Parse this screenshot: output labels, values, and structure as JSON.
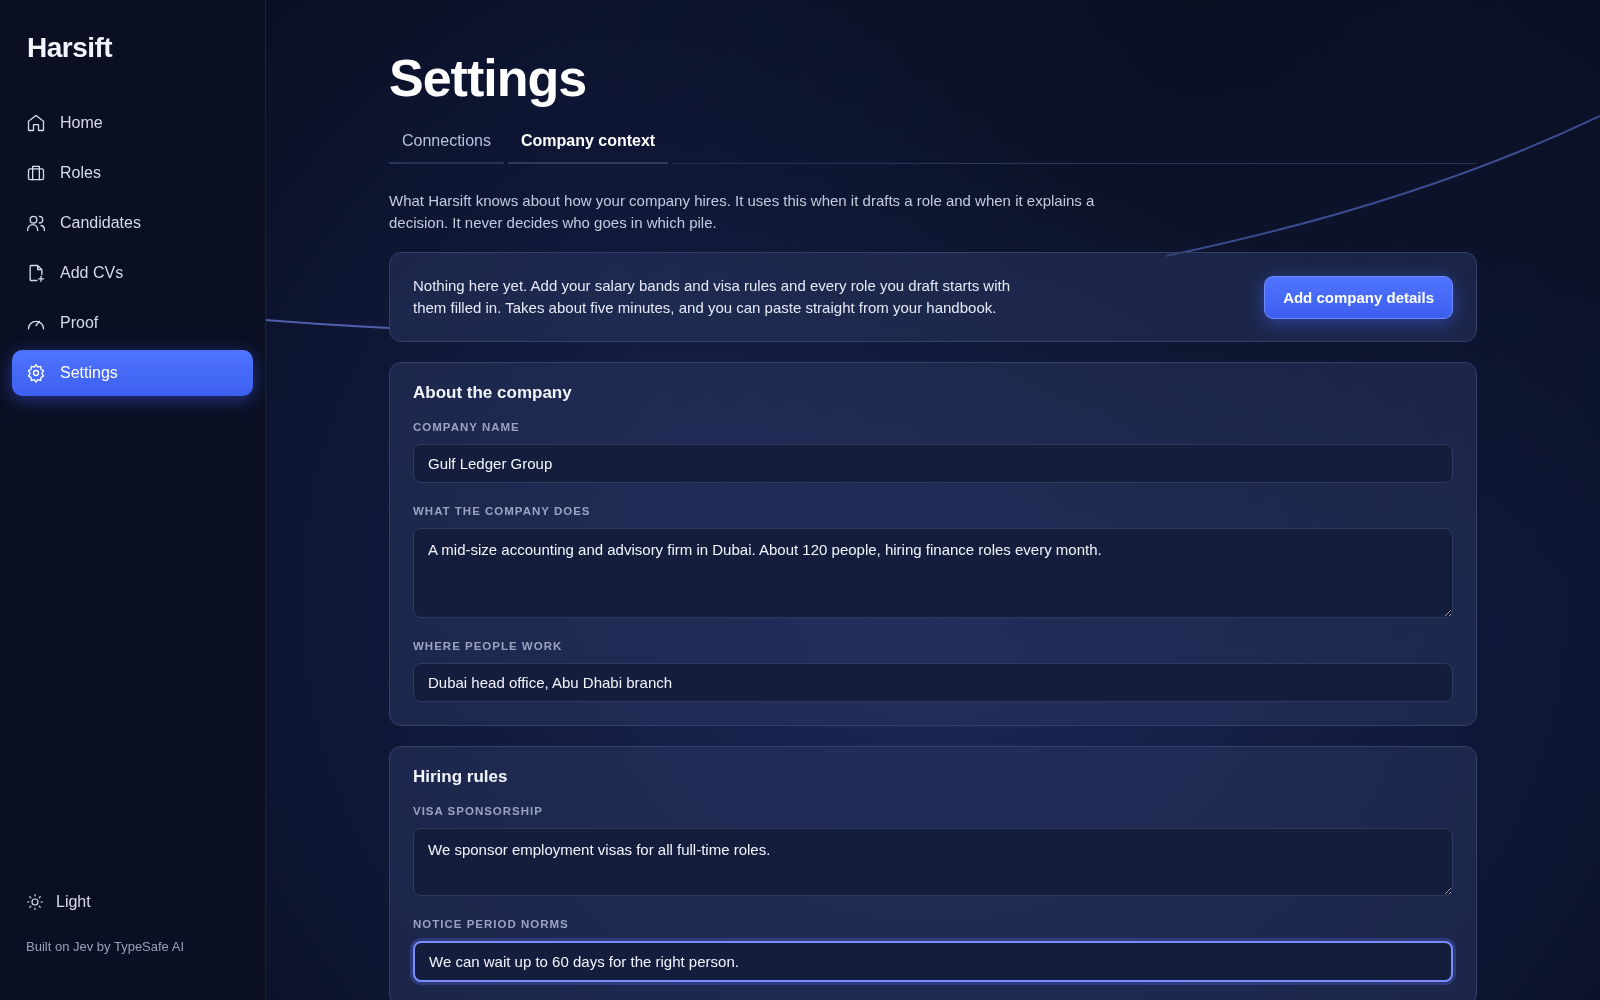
{
  "sidebar": {
    "brand": "Harsift",
    "items": [
      {
        "label": "Home",
        "selected": false
      },
      {
        "label": "Roles",
        "selected": false
      },
      {
        "label": "Candidates",
        "selected": false
      },
      {
        "label": "Add CVs",
        "selected": false
      },
      {
        "label": "Proof",
        "selected": false
      },
      {
        "label": "Settings",
        "selected": true
      }
    ],
    "theme_toggle": "Light",
    "footer": "Built on Jev by TypeSafe AI"
  },
  "page": {
    "title": "Settings",
    "tabs": [
      {
        "label": "Connections",
        "selected": false
      },
      {
        "label": "Company context",
        "selected": true
      }
    ],
    "intro": "What Harsift knows about how your company hires. It uses this when it drafts a role and when it explains a decision. It never decides who goes in which pile.",
    "banner": {
      "text": "Nothing here yet. Add your salary bands and visa rules and every role you draft starts with them filled in. Takes about five minutes, and you can paste straight from your handbook.",
      "button": "Add company details"
    },
    "sections": [
      {
        "title": "About the company",
        "fields": [
          {
            "label": "COMPANY NAME",
            "kind": "input",
            "value": "Gulf Ledger Group",
            "focused": false
          },
          {
            "label": "WHAT THE COMPANY DOES",
            "kind": "textarea",
            "value": "A mid-size accounting and advisory firm in Dubai. About 120 people, hiring finance roles every month.",
            "focused": false
          },
          {
            "label": "WHERE PEOPLE WORK",
            "kind": "input",
            "value": "Dubai head office, Abu Dhabi branch",
            "focused": false
          }
        ]
      },
      {
        "title": "Hiring rules",
        "fields": [
          {
            "label": "VISA SPONSORSHIP",
            "kind": "textarea",
            "value": "We sponsor employment visas for all full-time roles.",
            "focused": false
          },
          {
            "label": "NOTICE PERIOD NORMS",
            "kind": "input",
            "value": "We can wait up to 60 days for the right person.",
            "focused": true
          }
        ]
      }
    ]
  }
}
